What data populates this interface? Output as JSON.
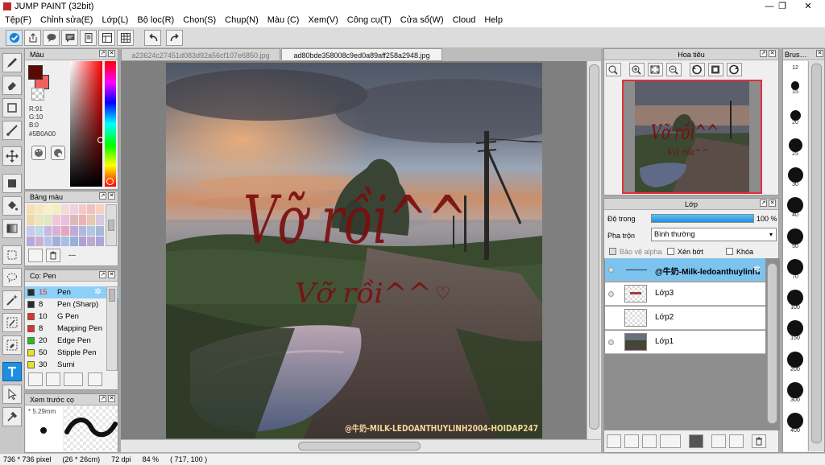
{
  "window": {
    "title": "JUMP PAINT (32bit)",
    "controls": {
      "minimize": "—",
      "maximize": "❐",
      "close": "✕"
    }
  },
  "menu": [
    "Tệp(F)",
    "Chỉnh sửa(E)",
    "Lớp(L)",
    "Bộ lọc(R)",
    "Chọn(S)",
    "Chụp(N)",
    "Màu (C)",
    "Xem(V)",
    "Công cụ(T)",
    "Cửa sổ(W)",
    "Cloud",
    "Help"
  ],
  "toolbar": {
    "icons": [
      "checkmark-icon",
      "export-icon",
      "comment-icon",
      "message-icon",
      "page-icon",
      "panel-icon",
      "grid-icon"
    ],
    "undo_icon": "undo-icon",
    "redo_icon": "redo-icon"
  },
  "tools": [
    "brush-tool-icon",
    "eraser-tool-icon",
    "rect-tool-icon",
    "line-tool-icon",
    "move-tool-icon",
    "fill-rect-tool-icon",
    "bucket-tool-icon",
    "gradient-tool-icon",
    "select-rect-tool-icon",
    "lasso-tool-icon",
    "magic-wand-tool-icon",
    "select-pen-tool-icon",
    "select-eraser-tool-icon",
    "text-tool-icon",
    "operation-tool-icon",
    "dropper-tool-icon"
  ],
  "color_panel": {
    "title": "Màu",
    "r": "R:91",
    "g": "G:10",
    "b": "B:0",
    "hex": "#5B0A00",
    "fg_color": "#5b0a00",
    "bg_color": "#f06060"
  },
  "palette_panel": {
    "title": "Bảng màu",
    "footer": "---",
    "swatches": [
      "#f7e0b8",
      "#f7e8c0",
      "#f8f0c8",
      "#f0f0c0",
      "#f8d8d8",
      "#f0d0e0",
      "#f4c8c8",
      "#f0c0c0",
      "#f8d0c0",
      "#f0d8a8",
      "#e8e8b8",
      "#e0e8c0",
      "#f0c8d8",
      "#e8c0e0",
      "#e0b8b8",
      "#f0b0b8",
      "#e8c8b0",
      "#d8c8e0",
      "#c8c8e8",
      "#c0d8e8",
      "#c8b8e0",
      "#d8b0d8",
      "#e0a8b8",
      "#c0a8d8",
      "#b0b8e0",
      "#b0c8e8",
      "#a8b8d8",
      "#b8a8d8",
      "#c8b0d0",
      "#b8c0e8",
      "#a0b0d8",
      "#a8c0e0",
      "#98b0d8",
      "#b0a0d0",
      "#c0a8d0",
      "#a8a8d8"
    ]
  },
  "pen_panel": {
    "title": "Cọ: Pen",
    "items": [
      {
        "size": "15",
        "name": "Pen",
        "color": "#2b2b2b",
        "selected": true
      },
      {
        "size": "8",
        "name": "Pen (Sharp)",
        "color": "#2b2b2b",
        "selected": false
      },
      {
        "size": "10",
        "name": "G Pen",
        "color": "#e03030",
        "selected": false
      },
      {
        "size": "8",
        "name": "Mapping Pen",
        "color": "#e03030",
        "selected": false
      },
      {
        "size": "20",
        "name": "Edge Pen",
        "color": "#20c020",
        "selected": false
      },
      {
        "size": "50",
        "name": "Stipple Pen",
        "color": "#e8e020",
        "selected": false
      },
      {
        "size": "30",
        "name": "Sumi",
        "color": "#e8e020",
        "selected": false
      }
    ]
  },
  "preview_panel": {
    "title": "Xem trước cọ",
    "size_label": "* 5.29mm"
  },
  "documents": {
    "tabs": [
      {
        "name": "a23624c27451d083d92a56cf107e6850.jpg",
        "active": false
      },
      {
        "name": "ad80bde358008c9ed0a89aff258a2948.jpg",
        "active": true
      }
    ]
  },
  "artwork": {
    "big_text": "Vỡ rồi^^",
    "small_text": "Vỡ rồi^^",
    "broken_heart": "♡",
    "watermark": "@牛奶-MILK-LEDOANTHUYLINH2004-HOIDAP247",
    "ink_color": "#7a0e0e"
  },
  "navigator_panel": {
    "title": "Hoa tiêu",
    "preview_text": "Vỡ rồi^^",
    "preview_small": "Vỡ rồi^^",
    "icons": [
      "zoom-fit-icon",
      "zoom-in-icon",
      "zoom-actual-icon",
      "zoom-out-icon",
      "rotate-left-icon",
      "rotate-reset-icon",
      "rotate-right-icon"
    ]
  },
  "layer_panel": {
    "title": "Lớp",
    "opacity_label": "Độ trong",
    "opacity_value": "100 %",
    "opacity": 1.0,
    "blend_label": "Pha trộn",
    "blend_value": "Bình thường",
    "protect_alpha": "Bảo vệ alpha",
    "clipping": "Xén bớt",
    "lock": "Khóa",
    "layers": [
      {
        "name": "@牛奶-Milk-ledoanthuylinh2004-",
        "selected": true
      },
      {
        "name": "Lớp3",
        "selected": false
      },
      {
        "name": "Lớp2",
        "selected": false
      },
      {
        "name": "Lớp1",
        "selected": false
      }
    ],
    "buttons": [
      "new-layer-icon",
      "new-folder-icon",
      "copy-layer-icon",
      "add-layer-menu-icon",
      "folder-icon",
      "duplicate-icon",
      "merge-icon",
      "delete-layer-icon"
    ]
  },
  "brush_list": {
    "title": "Brus…",
    "sizes": [
      "12",
      "15",
      "20",
      "25",
      "30",
      "40",
      "50",
      "70",
      "100",
      "150",
      "200",
      "300",
      "400"
    ]
  },
  "status": {
    "canvas_size": "736 * 736 pixel",
    "physical_size": "(26 * 26cm)",
    "dpi": "72 dpi",
    "zoom": "84 %",
    "cursor": "( 717, 100 )"
  }
}
